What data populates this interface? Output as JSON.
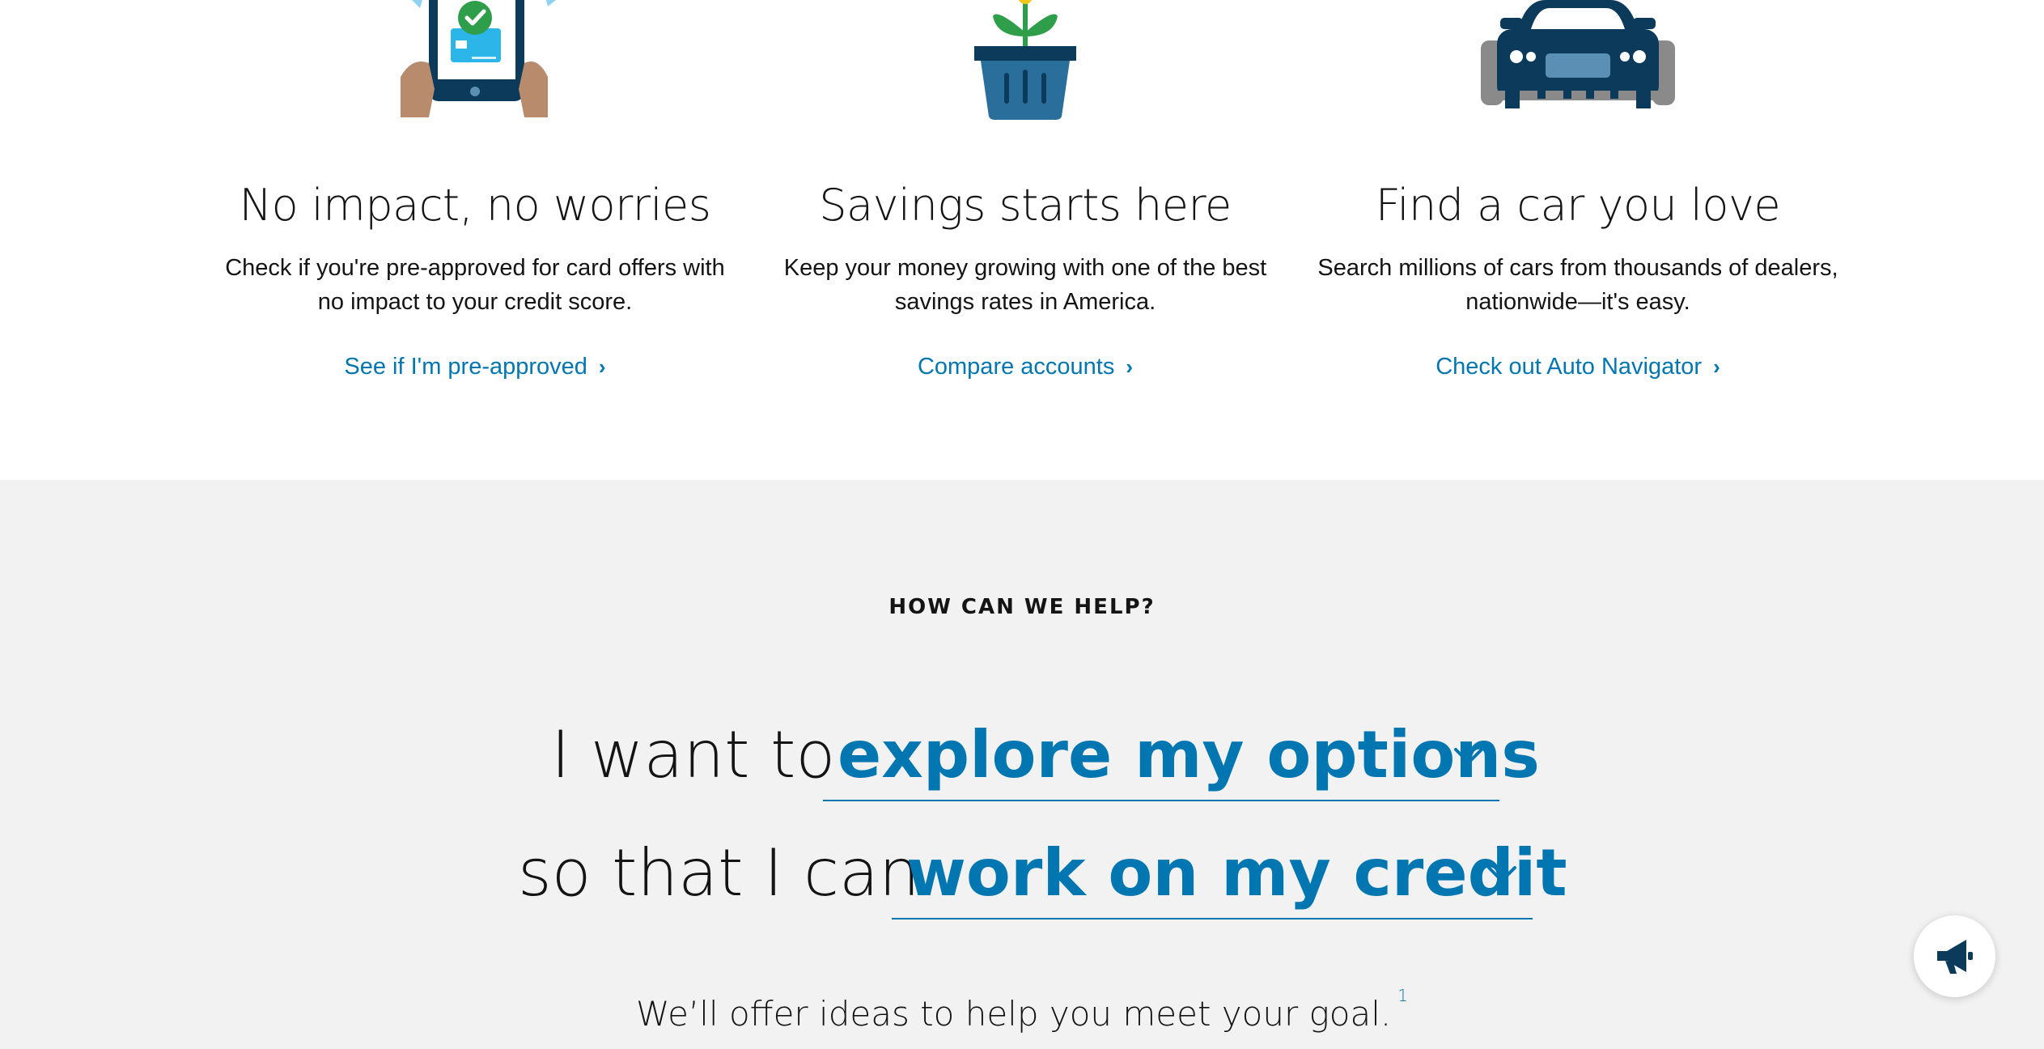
{
  "features": [
    {
      "icon": "phone-approval-illustration",
      "title": "No impact, no worries",
      "line1": "Check if you're pre-approved for card offers with",
      "line2": "no impact to your credit score.",
      "cta": "See if I'm pre-approved",
      "chevron": "›"
    },
    {
      "icon": "plant-basket-illustration",
      "title": "Savings starts here",
      "line1": "Keep your money growing with one of the best",
      "line2": "savings rates in America.",
      "cta": "Compare accounts",
      "chevron": "›"
    },
    {
      "icon": "car-illustration",
      "title": "Find a car you love",
      "line1": "Search millions of cars from thousands of dealers,",
      "line2": "nationwide—it's easy.",
      "cta": "Check out Auto Navigator",
      "chevron": "›"
    }
  ],
  "help": {
    "eyebrow": "HOW CAN WE HELP?",
    "row1_lead": "I want to",
    "row1_value": "explore my options",
    "row2_lead": "so that I can",
    "row2_value": "work on my credit",
    "offer": "We’ll offer ideas to help you meet your goal.",
    "footnote": "1"
  },
  "feedback_button": {
    "icon": "megaphone-icon"
  },
  "colors": {
    "link_blue": "#0276b1",
    "section_gray": "#f2f2f2",
    "navy": "#0b3a5b",
    "text": "#141414"
  }
}
